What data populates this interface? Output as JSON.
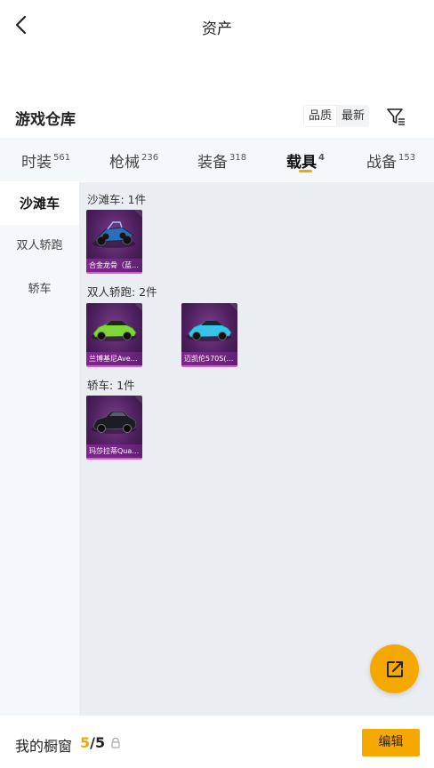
{
  "header": {
    "title": "资产"
  },
  "warehouse": {
    "title": "游戏仓库",
    "sort_options": [
      {
        "label": "品质",
        "active": true
      },
      {
        "label": "最新",
        "active": false
      }
    ]
  },
  "tabs": [
    {
      "label": "时装",
      "count": "561"
    },
    {
      "label": "枪械",
      "count": "236"
    },
    {
      "label": "装备",
      "count": "318"
    },
    {
      "label": "载具",
      "count": "4",
      "active": true
    },
    {
      "label": "战备",
      "count": "153"
    }
  ],
  "side_nav": [
    {
      "label": "沙滩车",
      "active": true
    },
    {
      "label": "双人轿跑"
    },
    {
      "label": "轿车"
    }
  ],
  "groups": [
    {
      "label": "沙滩车: 1件",
      "items": [
        {
          "name": "合金龙骨（蓝…",
          "icon": "buggy-icon",
          "color": "#2b6fb8"
        }
      ]
    },
    {
      "label": "双人轿跑: 2件",
      "items": [
        {
          "name": "兰博基尼Ave…",
          "icon": "sports-car-icon",
          "color": "#7fd63a"
        },
        {
          "name": "迈凯伦570S(…",
          "icon": "sports-car-icon",
          "color": "#39c3e6"
        }
      ]
    },
    {
      "label": "轿车: 1件",
      "items": [
        {
          "name": "玛莎拉蒂Qua…",
          "icon": "sedan-icon",
          "color": "#1c1c24"
        }
      ]
    }
  ],
  "bottom": {
    "showcase_label": "我的橱窗",
    "current": "5",
    "separator": "/",
    "total": "5",
    "edit_label": "编辑"
  },
  "colors": {
    "accent": "#f5a800",
    "card_bg": "#4e2060",
    "card_border": "#d65bdc"
  }
}
